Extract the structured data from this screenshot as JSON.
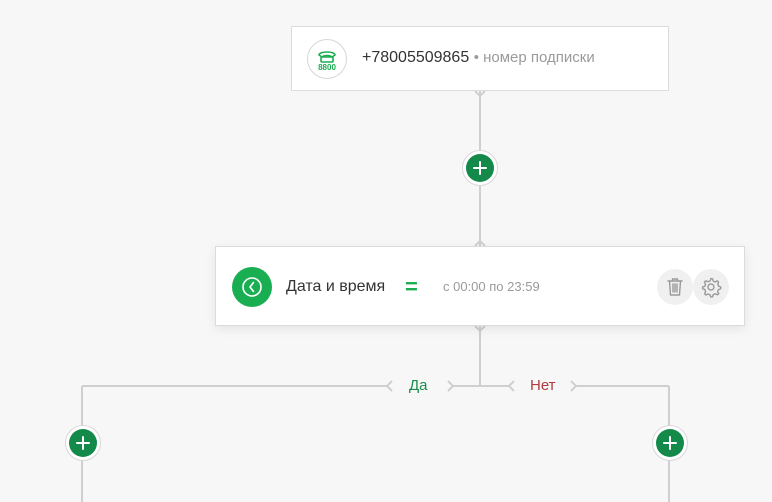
{
  "colors": {
    "background": "#f7f7f7",
    "accent_green": "#1aae52",
    "add_button_green": "#138a4a",
    "yes_color": "#1c8c4c",
    "no_color": "#b33b3b",
    "muted_text": "#9a9a9a"
  },
  "source_node": {
    "icon": "phone-8800-icon",
    "icon_text": "8800",
    "number": "+78005509865",
    "subtitle": "• номер подписки"
  },
  "condition_node": {
    "icon": "clock-icon",
    "title": "Дата и время",
    "operator": "=",
    "value": "с 00:00 по 23:59",
    "delete_icon": "trash-icon",
    "settings_icon": "gear-icon"
  },
  "branches": {
    "yes_label": "Да",
    "no_label": "Нет"
  },
  "add_buttons": {
    "icon": "plus-icon"
  }
}
